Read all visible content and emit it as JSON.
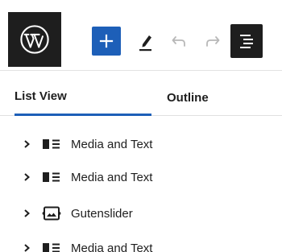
{
  "toolbar": {
    "logo": "wordpress-logo",
    "buttons": [
      {
        "name": "add-block-button",
        "icon": "plus-icon"
      },
      {
        "name": "tools-button",
        "icon": "pencil-icon"
      },
      {
        "name": "undo-button",
        "icon": "undo-icon"
      },
      {
        "name": "redo-button",
        "icon": "redo-icon"
      },
      {
        "name": "list-view-button",
        "icon": "list-view-icon"
      }
    ],
    "accent_color": "#1d5fb8"
  },
  "tabs": [
    {
      "label": "List View",
      "active": true
    },
    {
      "label": "Outline",
      "active": false
    }
  ],
  "list": {
    "items": [
      {
        "label": "Media and Text",
        "icon": "media-text-icon"
      },
      {
        "label": "Media and Text",
        "icon": "media-text-icon"
      },
      {
        "label": "Gutenslider",
        "icon": "gutenslider-icon"
      },
      {
        "label": "Media and Text",
        "icon": "media-text-icon"
      }
    ]
  }
}
